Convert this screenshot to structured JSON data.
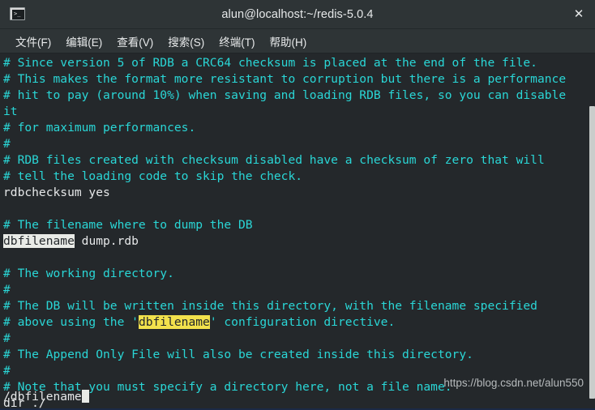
{
  "window": {
    "title": "alun@localhost:~/redis-5.0.4",
    "app_icon": "terminal-icon",
    "icon_prompt_glyph": ">_",
    "close_label": "✕"
  },
  "menubar": {
    "items": [
      {
        "label": "文件(F)"
      },
      {
        "label": "编辑(E)"
      },
      {
        "label": "查看(V)"
      },
      {
        "label": "搜索(S)"
      },
      {
        "label": "终端(T)"
      },
      {
        "label": "帮助(H)"
      }
    ]
  },
  "terminal": {
    "lines": [
      {
        "segments": [
          {
            "text": "# Since version 5 of RDB a CRC64 checksum is placed at the end of the file.",
            "style": "comment"
          }
        ]
      },
      {
        "segments": [
          {
            "text": "# This makes the format more resistant to corruption but there is a performance",
            "style": "comment"
          }
        ]
      },
      {
        "segments": [
          {
            "text": "# hit to pay (around 10%) when saving and loading RDB files, so you can disable",
            "style": "comment"
          }
        ]
      },
      {
        "segments": [
          {
            "text": "it",
            "style": "comment"
          }
        ]
      },
      {
        "segments": [
          {
            "text": "# for maximum performances.",
            "style": "comment"
          }
        ]
      },
      {
        "segments": [
          {
            "text": "#",
            "style": "comment"
          }
        ]
      },
      {
        "segments": [
          {
            "text": "# RDB files created with checksum disabled have a checksum of zero that will",
            "style": "comment"
          }
        ]
      },
      {
        "segments": [
          {
            "text": "# tell the loading code to skip the check.",
            "style": "comment"
          }
        ]
      },
      {
        "segments": [
          {
            "text": "rdbchecksum yes",
            "style": "plain"
          }
        ]
      },
      {
        "segments": [
          {
            "text": "",
            "style": "plain"
          }
        ]
      },
      {
        "segments": [
          {
            "text": "# The filename where to dump the DB",
            "style": "comment"
          }
        ]
      },
      {
        "segments": [
          {
            "text": "dbfilename",
            "style": "current-match"
          },
          {
            "text": " dump.rdb",
            "style": "plain"
          }
        ]
      },
      {
        "segments": [
          {
            "text": "",
            "style": "plain"
          }
        ]
      },
      {
        "segments": [
          {
            "text": "# The working directory.",
            "style": "comment"
          }
        ]
      },
      {
        "segments": [
          {
            "text": "#",
            "style": "comment"
          }
        ]
      },
      {
        "segments": [
          {
            "text": "# The DB will be written inside this directory, with the filename specified",
            "style": "comment"
          }
        ]
      },
      {
        "segments": [
          {
            "text": "# above using the '",
            "style": "comment"
          },
          {
            "text": "dbfilename",
            "style": "search-match"
          },
          {
            "text": "' configuration directive.",
            "style": "comment"
          }
        ]
      },
      {
        "segments": [
          {
            "text": "#",
            "style": "comment"
          }
        ]
      },
      {
        "segments": [
          {
            "text": "# The Append Only File will also be created inside this directory.",
            "style": "comment"
          }
        ]
      },
      {
        "segments": [
          {
            "text": "#",
            "style": "comment"
          }
        ]
      },
      {
        "segments": [
          {
            "text": "# Note that you must specify a directory here, not a file name.",
            "style": "comment"
          }
        ]
      },
      {
        "segments": [
          {
            "text": "dir ./",
            "style": "plain"
          }
        ]
      }
    ],
    "command_line": "/dbfilename",
    "cursor": "block",
    "watermark": "https://blog.csdn.net/alun550"
  },
  "colors": {
    "background": "#24282b",
    "chrome": "#2e3436",
    "comment": "#2ad6d6",
    "plain_text": "#e6e8e9",
    "current_match_bg": "#e9ebe7",
    "search_match_bg": "#f2e14c",
    "bottom_border": "#1b2a46"
  }
}
